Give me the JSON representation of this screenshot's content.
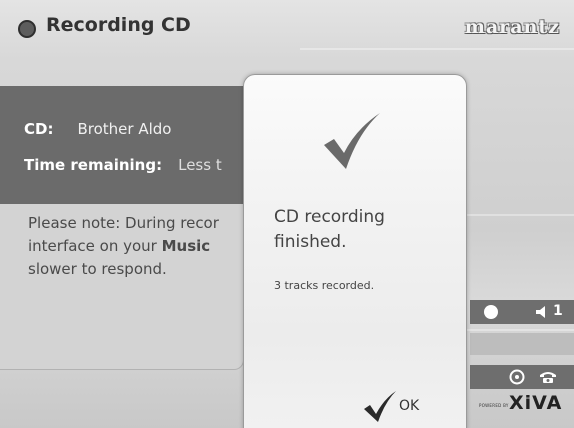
{
  "header": {
    "title": "Recording CD",
    "brand": "marantz"
  },
  "info": {
    "cd_label": "CD:",
    "cd_value": "Brother Aldo",
    "time_label": "Time remaining:",
    "time_value": "Less t"
  },
  "note": {
    "line1": "Please note: During recor",
    "line2_pre": "interface on your ",
    "line2_bold": "Music",
    "line3": "slower to respond."
  },
  "dialog": {
    "icon": "check-icon",
    "title": "CD recording finished.",
    "subtitle": "3 tracks recorded.",
    "ok_label": "OK"
  },
  "status": {
    "volume_level": "1"
  },
  "footer": {
    "powered_by": "POWERED BY",
    "logo": "XiVA"
  }
}
